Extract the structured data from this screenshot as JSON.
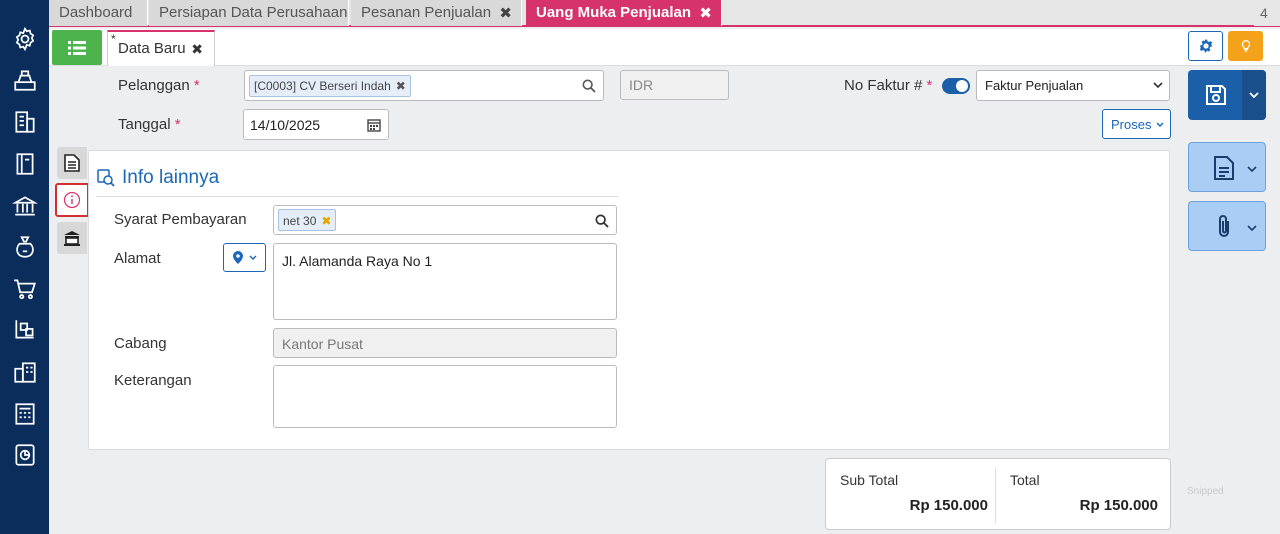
{
  "tabs": [
    {
      "label": "Dashboard",
      "closable": false,
      "active": false
    },
    {
      "label": "Persiapan Data Perusahaan",
      "closable": false,
      "active": false
    },
    {
      "label": "Pesanan Penjualan",
      "closable": true,
      "active": false
    },
    {
      "label": "Uang Muka Penjualan",
      "closable": true,
      "active": true
    }
  ],
  "tab_count": "4",
  "subtab": {
    "modified_mark": "*",
    "label": "Data Baru",
    "close": "✖"
  },
  "close_glyph": "✖",
  "form": {
    "pelanggan_label": "Pelanggan",
    "pelanggan_value": "[C0003] CV Berseri Indah",
    "currency": "IDR",
    "no_faktur_label": "No Faktur #",
    "faktur_type": "Faktur Penjualan",
    "tanggal_label": "Tanggal",
    "tanggal_value": "14/10/2025",
    "required_mark": "*",
    "proses_label": "Proses"
  },
  "info": {
    "title": "Info lainnya",
    "syarat_label": "Syarat Pembayaran",
    "syarat_value": "net 30",
    "alamat_label": "Alamat",
    "alamat_value": "Jl. Alamanda Raya No 1",
    "cabang_label": "Cabang",
    "cabang_value": "Kantor Pusat",
    "keterangan_label": "Keterangan",
    "keterangan_value": ""
  },
  "totals": {
    "subtotal_label": "Sub Total",
    "subtotal_value": "Rp 150.000",
    "total_label": "Total",
    "total_value": "Rp 150.000"
  },
  "watermark": "Snipped",
  "colors": {
    "nav": "#0b2d5b",
    "accent": "#d6336c",
    "primary": "#1b5fa8",
    "green": "#4db34d",
    "amber": "#f5a21b"
  }
}
